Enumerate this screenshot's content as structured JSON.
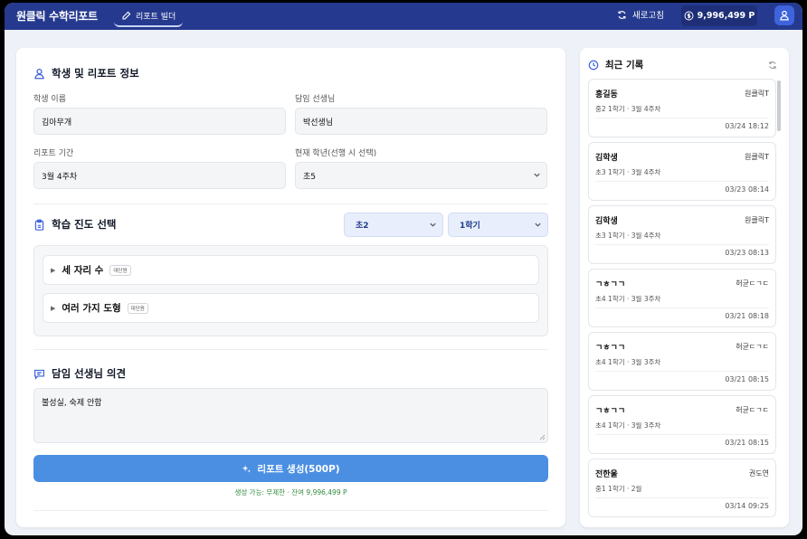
{
  "app": {
    "title": "원클릭 수학리포트",
    "nav_tab": "리포트 빌더"
  },
  "topbar": {
    "refresh_label": "새로고침",
    "points": "9,996,499 P"
  },
  "student_section": {
    "title": "학생 및 리포트 정보",
    "student_name_label": "학생 이름",
    "student_name_value": "김아무개",
    "teacher_label": "담임 선생님",
    "teacher_value": "박선생님",
    "period_label": "리포트 기간",
    "period_value": "3월 4주차",
    "grade_label": "현재 학년(선행 시 선택)",
    "grade_value": "초5"
  },
  "progress_section": {
    "title": "학습 진도 선택",
    "grade_select": "초2",
    "semester_select": "1학기",
    "units": [
      {
        "name": "세 자리 수",
        "badge": "대단원"
      },
      {
        "name": "여러 가지 도형",
        "badge": "대단원"
      }
    ]
  },
  "comment_section": {
    "title": "담임 선생님 의견",
    "value": "불성실, 숙제 안함"
  },
  "generate": {
    "button_label": "리포트 생성(500P)",
    "status": "생성 가능: 무제한 · 잔여 9,996,499 P"
  },
  "history": {
    "title": "최근 기록",
    "items": [
      {
        "name": "홍길동",
        "teacher": "원클릭T",
        "meta": "중2 1학기 · 3월 4주차",
        "date": "03/24 18:12"
      },
      {
        "name": "김학생",
        "teacher": "원클릭T",
        "meta": "초3 1학기 · 3월 4주차",
        "date": "03/23 08:14"
      },
      {
        "name": "김학생",
        "teacher": "원클릭T",
        "meta": "초3 1학기 · 3월 4주차",
        "date": "03/23 08:13"
      },
      {
        "name": "ㄱㅎㄱㄱ",
        "teacher": "허균ㄷㄱㄷ",
        "meta": "초4 1학기 · 3월 3주차",
        "date": "03/21 08:18"
      },
      {
        "name": "ㄱㅎㄱㄱ",
        "teacher": "허균ㄷㄱㄷ",
        "meta": "초4 1학기 · 3월 3주차",
        "date": "03/21 08:15"
      },
      {
        "name": "ㄱㅎㄱㄱ",
        "teacher": "허균ㄷㄱㄷ",
        "meta": "초4 1학기 · 3월 3주차",
        "date": "03/21 08:15"
      },
      {
        "name": "전한울",
        "teacher": "권도연",
        "meta": "중1 1학기 · 2월",
        "date": "03/14 09:25"
      }
    ]
  },
  "colors": {
    "topbar": "#253a8f",
    "accent": "#4b8fe2",
    "status_green": "#2f8a3a"
  }
}
